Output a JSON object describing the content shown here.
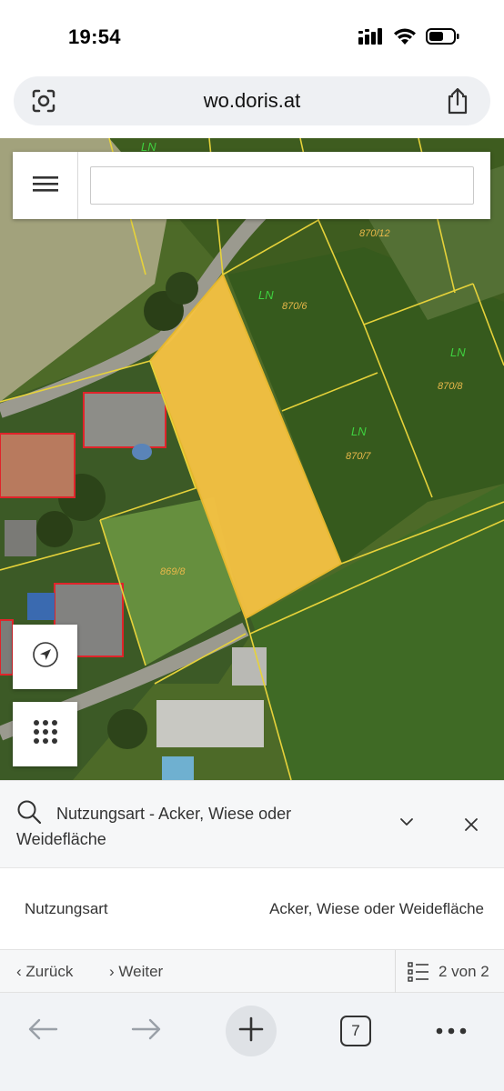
{
  "status_bar": {
    "time": "19:54"
  },
  "browser": {
    "url": "wo.doris.at",
    "tab_count": "7"
  },
  "map": {
    "search": {
      "value": "",
      "placeholder": ""
    },
    "parcel_labels": [
      {
        "text": "870/12",
        "kind": "parcel"
      },
      {
        "text": "870/6",
        "kind": "parcel"
      },
      {
        "text": "870/8",
        "kind": "parcel"
      },
      {
        "text": "870/7",
        "kind": "parcel"
      },
      {
        "text": "869/8",
        "kind": "parcel"
      },
      {
        "text": "LN",
        "kind": "use"
      },
      {
        "text": "LN",
        "kind": "use"
      },
      {
        "text": "LN",
        "kind": "use"
      },
      {
        "text": "LN",
        "kind": "use"
      }
    ],
    "colors": {
      "selected_parcel": "#f5c242",
      "parcel_lines": "#e6d23a",
      "building_outline": "#e0242a",
      "label_green": "#3fd13f"
    }
  },
  "feature_info": {
    "title": "Nutzungsart - Acker, Wiese oder Weidefläche",
    "attribute_key": "Nutzungsart",
    "attribute_value": "Acker, Wiese oder Weidefläche",
    "back_label": "Zurück",
    "next_label": "Weiter",
    "page_count": "2 von 2"
  }
}
